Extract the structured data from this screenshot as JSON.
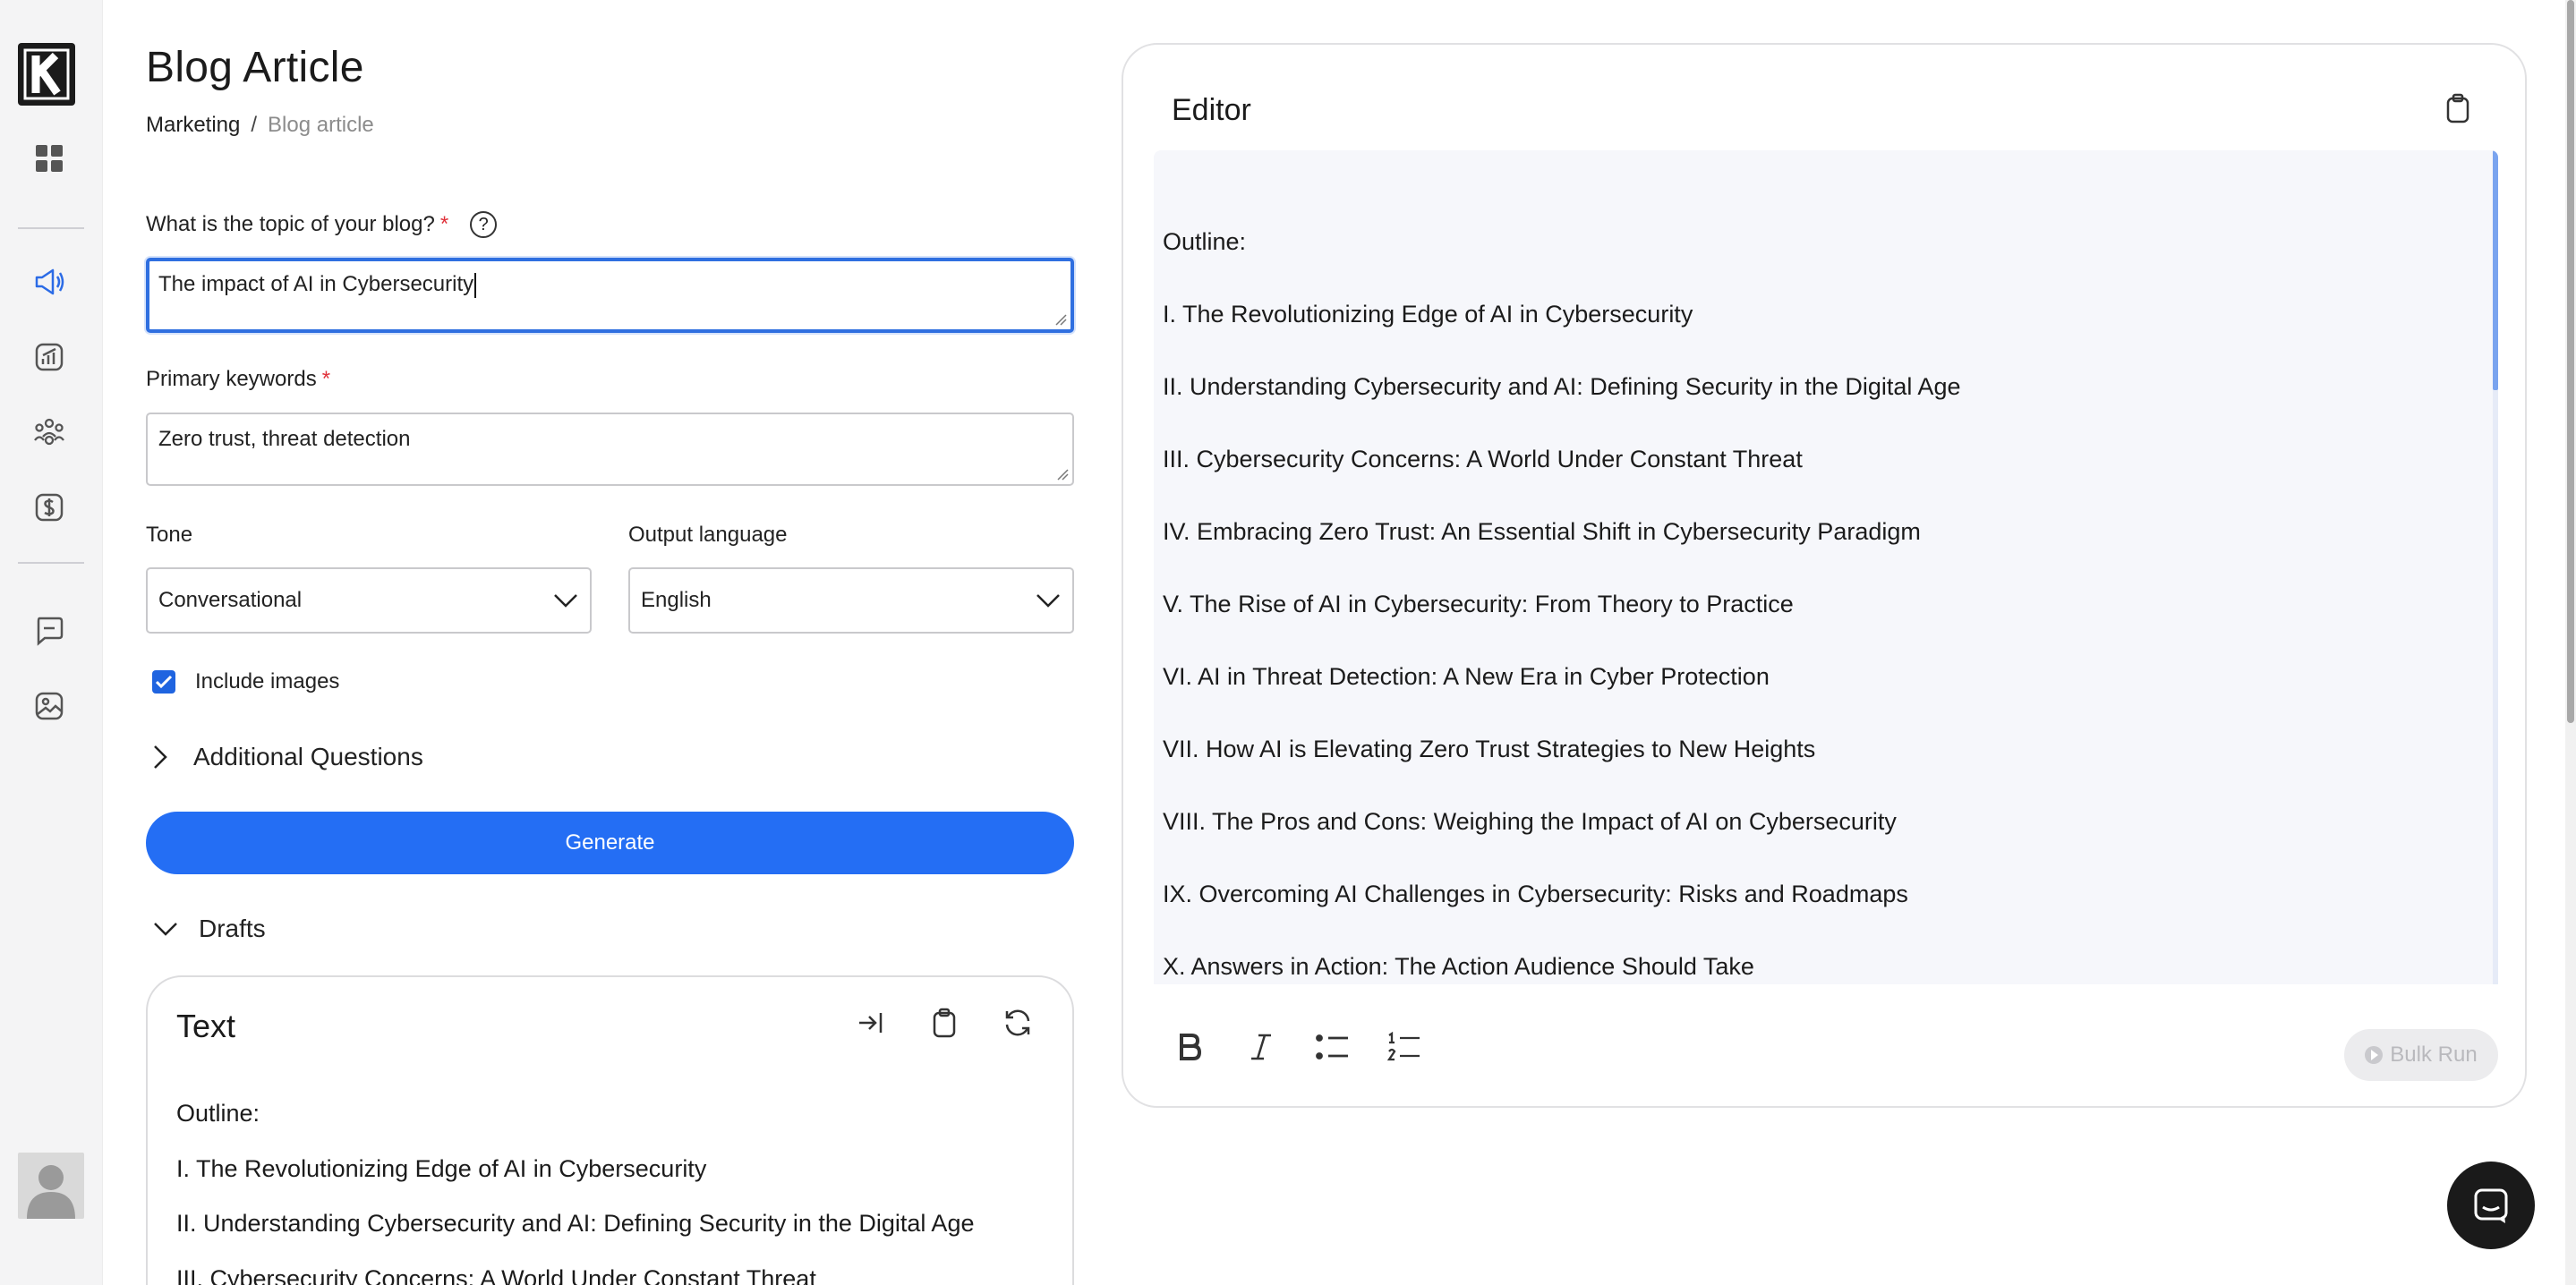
{
  "page": {
    "title": "Blog Article",
    "breadcrumb": {
      "parent": "Marketing",
      "separator": "/",
      "current": "Blog article"
    }
  },
  "sidebar": {
    "logo_letter": "K",
    "icons": [
      "grid-icon",
      "megaphone-icon",
      "analytics-icon",
      "team-icon",
      "dollar-icon",
      "chat-bubble-icon",
      "image-icon"
    ]
  },
  "form": {
    "topic": {
      "label": "What is the topic of your blog?",
      "required": "*",
      "help": "?",
      "value": "The impact of AI in Cybersecurity"
    },
    "keywords": {
      "label": "Primary keywords",
      "required": "*",
      "value": "Zero trust, threat detection"
    },
    "tone": {
      "label": "Tone",
      "value": "Conversational"
    },
    "language": {
      "label": "Output language",
      "value": "English"
    },
    "include_images": {
      "label": "Include images",
      "checked": true
    },
    "additional_questions": "Additional Questions",
    "generate_label": "Generate"
  },
  "drafts": {
    "label": "Drafts",
    "card_title": "Text",
    "lines": [
      "Outline:",
      "I. The Revolutionizing Edge of AI in Cybersecurity",
      "II. Understanding Cybersecurity and AI: Defining Security in the Digital Age",
      "III. Cybersecurity Concerns: A World Under Constant Threat"
    ]
  },
  "editor": {
    "title": "Editor",
    "lines": [
      "Outline:",
      "I. The Revolutionizing Edge of AI in Cybersecurity",
      "II. Understanding Cybersecurity and AI: Defining Security in the Digital Age",
      "III. Cybersecurity Concerns: A World Under Constant Threat",
      "IV. Embracing Zero Trust: An Essential Shift in Cybersecurity Paradigm",
      "V. The Rise of AI in Cybersecurity: From Theory to Practice",
      "VI. AI in Threat Detection: A New Era in Cyber Protection",
      "VII. How AI is Elevating Zero Trust Strategies to New Heights",
      "VIII. The Pros and Cons: Weighing the Impact of AI on Cybersecurity",
      "IX. Overcoming AI Challenges in Cybersecurity: Risks and Roadmaps",
      "X. Answers in Action: The Action Audience Should Take"
    ],
    "bulk_run_label": "Bulk Run"
  },
  "colors": {
    "accent": "#246ef4",
    "required": "#e0323b",
    "sidebar_bg": "#f4f4f5"
  }
}
